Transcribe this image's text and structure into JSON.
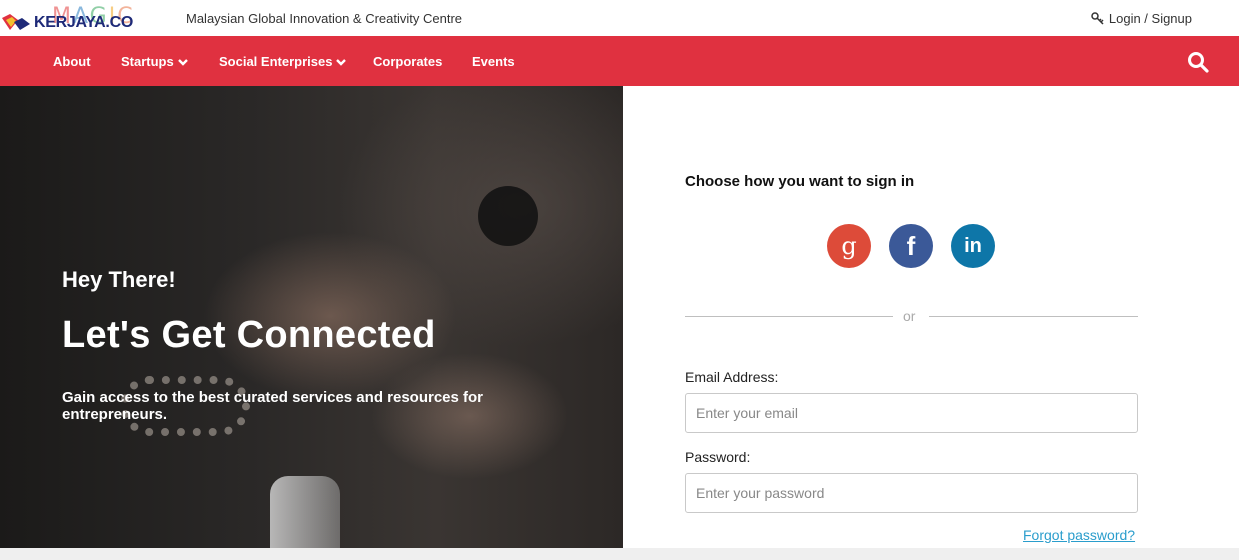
{
  "brand": {
    "kerjaya_text": "KERJAYA.CO",
    "magic_text": "MAGIC",
    "org_name": "Malaysian Global Innovation & Creativity Centre",
    "colors": {
      "primary_red": "#e03140",
      "brand_blue": "#1e2a78"
    }
  },
  "header": {
    "login_label": "Login / Signup",
    "login_icon": "key-icon"
  },
  "nav": {
    "items": [
      {
        "label": "About",
        "has_dropdown": false
      },
      {
        "label": "Startups",
        "has_dropdown": true
      },
      {
        "label": "Social Enterprises",
        "has_dropdown": true
      },
      {
        "label": "Corporates",
        "has_dropdown": false
      },
      {
        "label": "Events",
        "has_dropdown": false
      }
    ],
    "search_icon": "search-icon"
  },
  "hero": {
    "greeting": "Hey There!",
    "title": "Let's Get Connected",
    "description": "Gain access to the best curated services and resources for entrepreneurs."
  },
  "signin": {
    "heading": "Choose how you want to sign in",
    "social": [
      {
        "name": "google",
        "glyph": "g",
        "color": "#dd4b39"
      },
      {
        "name": "facebook",
        "glyph": "f",
        "color": "#3b5998"
      },
      {
        "name": "linkedin",
        "glyph": "in",
        "color": "#0e76a8"
      }
    ],
    "divider_text": "or",
    "email_label": "Email Address:",
    "email_placeholder": "Enter your email",
    "email_value": "",
    "password_label": "Password:",
    "password_placeholder": "Enter your password",
    "password_value": "",
    "forgot_label": "Forgot password?"
  }
}
